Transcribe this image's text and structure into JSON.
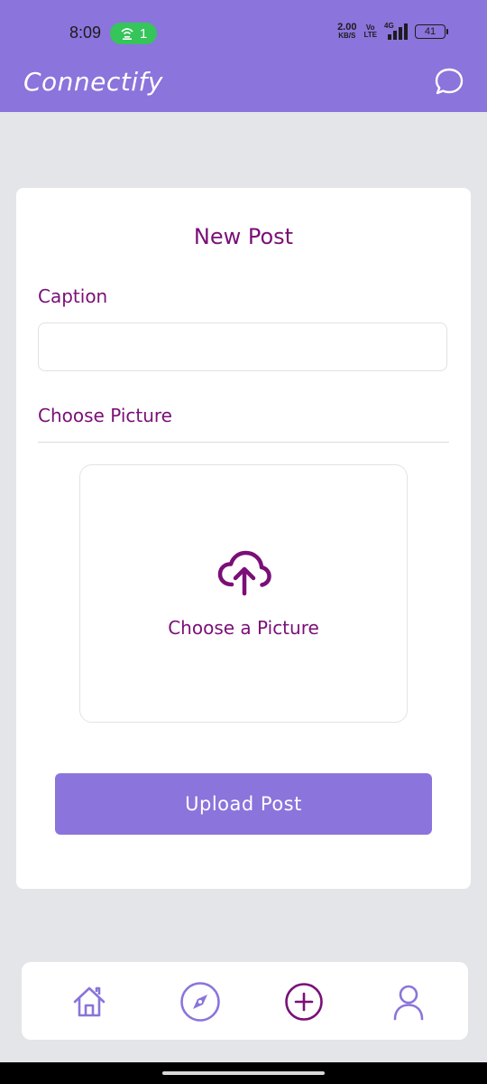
{
  "status_bar": {
    "time": "8:09",
    "hotspot_count": "1",
    "net_speed_value": "2.00",
    "net_speed_unit": "KB/S",
    "volte_top": "Vo",
    "volte_bottom": "LTE",
    "network_type": "4G",
    "battery_level": "41"
  },
  "app_bar": {
    "title": "Connectify",
    "chat_icon": "chat-bubble-icon"
  },
  "new_post": {
    "title": "New Post",
    "caption_label": "Caption",
    "caption_value": "",
    "caption_placeholder": "",
    "choose_label": "Choose Picture",
    "picker_text": "Choose a Picture",
    "picker_icon": "cloud-upload-icon",
    "upload_button": "Upload Post"
  },
  "bottom_nav": {
    "items": [
      {
        "icon": "home-icon",
        "selected": false
      },
      {
        "icon": "compass-icon",
        "selected": false
      },
      {
        "icon": "add-circle-icon",
        "selected": true
      },
      {
        "icon": "user-icon",
        "selected": false
      }
    ]
  },
  "colors": {
    "brand": "#8b74db",
    "accent_text": "#7a0f77",
    "background": "#e4e5e9",
    "nav_inactive": "#8b74db",
    "hotspot": "#35c55a"
  }
}
